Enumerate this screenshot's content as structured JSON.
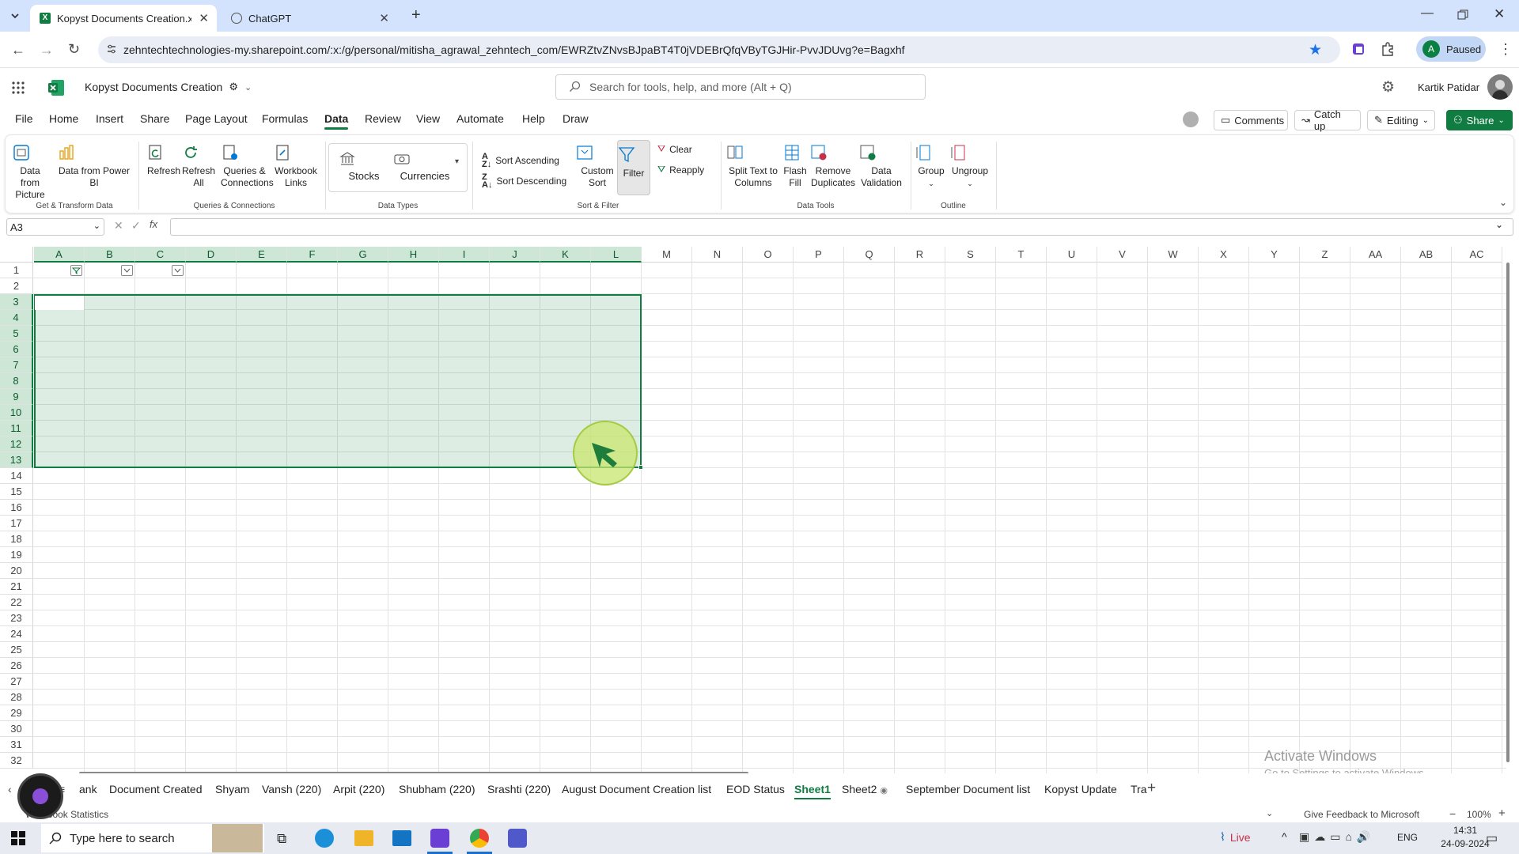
{
  "browser": {
    "tabs": [
      {
        "title": "Kopyst Documents Creation.xlsx",
        "active": true
      },
      {
        "title": "ChatGPT",
        "active": false
      }
    ],
    "url": "zehntechtechnologies-my.sharepoint.com/:x:/g/personal/mitisha_agrawal_zehntech_com/EWRZtvZNvsBJpaBT4T0jVDEBrQfqVByTGJHir-PvvJDUvg?e=Bagxhf",
    "profile_initial": "A",
    "profile_status": "Paused"
  },
  "app": {
    "doc_title": "Kopyst Documents Creation",
    "search_placeholder": "Search for tools, help, and more (Alt + Q)",
    "user_name": "Kartik Patidar"
  },
  "menu": {
    "items": [
      "File",
      "Home",
      "Insert",
      "Share",
      "Page Layout",
      "Formulas",
      "Data",
      "Review",
      "View",
      "Automate",
      "Help",
      "Draw"
    ],
    "active": "Data",
    "comments": "Comments",
    "catchup": "Catch up",
    "editing": "Editing",
    "share": "Share"
  },
  "ribbon": {
    "data_from_picture": "Data from Picture",
    "data_from_powerbi": "Data from Power BI",
    "group_get_transform": "Get & Transform Data",
    "refresh": "Refresh",
    "refresh_all": "Refresh All",
    "queries_connections": "Queries & Connections",
    "workbook_links": "Workbook Links",
    "group_queries": "Queries & Connections",
    "stocks": "Stocks",
    "currencies": "Currencies",
    "group_data_types": "Data Types",
    "sort_ascending": "Sort Ascending",
    "sort_descending": "Sort Descending",
    "custom_sort": "Custom Sort",
    "filter": "Filter",
    "clear": "Clear",
    "reapply": "Reapply",
    "group_sort_filter": "Sort & Filter",
    "split_text": "Split Text to Columns",
    "flash_fill": "Flash Fill",
    "remove_duplicates": "Remove Duplicates",
    "data_validation": "Data Validation",
    "group_data_tools": "Data Tools",
    "group": "Group",
    "ungroup": "Ungroup",
    "group_outline": "Outline"
  },
  "formula_bar": {
    "name_box": "A3",
    "formula": ""
  },
  "grid": {
    "columns": [
      "A",
      "B",
      "C",
      "D",
      "E",
      "F",
      "G",
      "H",
      "I",
      "J",
      "K",
      "L",
      "M",
      "N",
      "O",
      "P",
      "Q",
      "R",
      "S",
      "T",
      "U",
      "V",
      "W",
      "X",
      "Y",
      "Z",
      "AA",
      "AB",
      "AC"
    ],
    "rows": [
      "1",
      "2",
      "3",
      "4",
      "5",
      "6",
      "7",
      "8",
      "9",
      "10",
      "11",
      "12",
      "13",
      "14",
      "15",
      "16",
      "17",
      "18",
      "19",
      "20",
      "21",
      "22",
      "23",
      "24",
      "25",
      "26",
      "27",
      "28",
      "29",
      "30",
      "31",
      "32"
    ],
    "selection": "A3:L13"
  },
  "sheets": {
    "tabs": [
      "ank",
      "Document Created",
      "Shyam",
      "Vansh (220)",
      "Arpit (220)",
      "Shubham (220)",
      "Srashti (220)",
      "August Document Creation list",
      "EOD Status",
      "Sheet1",
      "Sheet2",
      "September Document list",
      "Kopyst Update",
      "Tra"
    ],
    "active": "Sheet1"
  },
  "watermark": {
    "line1": "Activate Windows",
    "line2": "Go to Settings to activate Windows."
  },
  "status": {
    "left": "Workbook Statistics",
    "feedback": "Give Feedback to Microsoft",
    "zoom": "100%"
  },
  "taskbar": {
    "search_placeholder": "Type here to search",
    "live": "Live",
    "lang": "ENG",
    "time": "14:31",
    "date": "24-09-2024"
  },
  "colors": {
    "excel_green": "#107c41",
    "selection_fill": "#daeee1",
    "browser_tab_bg": "#d3e3fd"
  }
}
